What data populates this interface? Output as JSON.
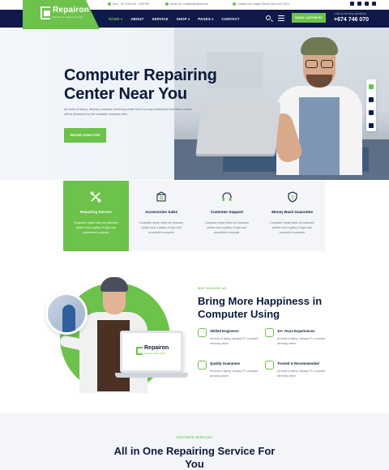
{
  "brand": {
    "name": "Repairon",
    "tagline": "Mobile & Laptop Repair",
    "accent": "#6cc24a",
    "navy": "#0f1a4a"
  },
  "topbar": {
    "hours": "Mon - Fri: 8:00 AM - 6:00 PM",
    "email": "Email Us: contact@repair.com",
    "address": "Contact Us: Staple Street New York 2023"
  },
  "nav": {
    "items": [
      {
        "label": "HOME"
      },
      {
        "label": "ABOUT"
      },
      {
        "label": "SERVICE"
      },
      {
        "label": "SHOP"
      },
      {
        "label": "PAGES"
      },
      {
        "label": "CONTACT"
      }
    ],
    "cta": "BUILD CUSTOM PC",
    "call_label": "Call us for any question",
    "phone": "+674 746 070"
  },
  "hero": {
    "title": "Computer Repairing Center Near You",
    "description": "All kinds of laptop, desktop computer servicing center hurt is a long established fact that a reader will be distracted by the readable computer disk.",
    "button": "REPAIR COMPUTER"
  },
  "services": [
    {
      "icon": "tools-icon",
      "title": "Repairing Service",
      "desc": "Computer repair when an unknown printer took a galley of type and scrambled computer"
    },
    {
      "icon": "box-sale-icon",
      "title": "Accessories Sales",
      "desc": "Computer repair when an unknown printer took a galley of type and scrambled computer"
    },
    {
      "icon": "headset-icon",
      "title": "Customer Support",
      "desc": "Computer repair when an unknown printer took a galley of type and scrambled computer"
    },
    {
      "icon": "money-shield-icon",
      "title": "Money Back Guarantee",
      "desc": "Computer repair when an unknown printer took a galley of type and scrambled computer"
    }
  ],
  "why": {
    "label": "WHY CHOOSE US",
    "title": "Bring More Happiness in Computer Using",
    "screen_logo": "Repairon",
    "screen_sub": "Mobile & Laptop Repair",
    "features": [
      {
        "icon": "engineer-icon",
        "title": "Skilled Engineers",
        "desc": "All kinds of laptop, desktop PC computer servicing center"
      },
      {
        "icon": "experience-icon",
        "title": "10+ Years Experiences",
        "desc": "All kinds of laptop, desktop PC computer servicing center"
      },
      {
        "icon": "quality-icon",
        "title": "Quality Guarantee",
        "desc": "All kinds of laptop, desktop PC computer servicing center"
      },
      {
        "icon": "trust-icon",
        "title": "Trusted & Recommended",
        "desc": "All kinds of laptop, desktop PC computer servicing center"
      }
    ]
  },
  "featured": {
    "label": "FEATURED SERVICES",
    "title": "All in One Repairing Service For You"
  }
}
